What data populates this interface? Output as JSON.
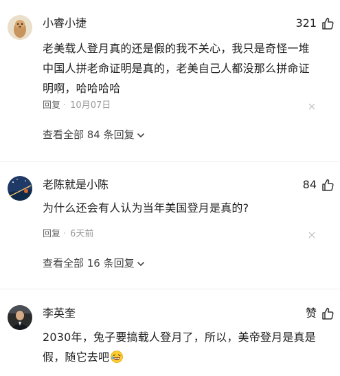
{
  "comments": [
    {
      "user": "小睿小捷",
      "likes": "321",
      "text": "老美载人登月真的还是假的我不关心，我只是奇怪一堆中国人拼老命证明是真的，老美自己人都没那么拼命证明啊，哈哈哈哈",
      "reply_label": "回复",
      "date": "10月07日",
      "view_replies": "查看全部 84 条回复"
    },
    {
      "user": "老陈就是小陈",
      "likes": "84",
      "text": "为什么还会有人认为当年美国登月是真的?",
      "reply_label": "回复",
      "date": "6天前",
      "view_replies": "查看全部 16 条回复"
    },
    {
      "user": "李英奎",
      "likes": "赞",
      "text": "2030年，兔子要搞载人登月了，所以，美帝登月是真是假，随它去吧"
    }
  ],
  "icons": {
    "like": "thumbs-up-icon",
    "close": "close-icon",
    "expand": "chevron-down-icon",
    "emoji": "laughing-emoji-icon"
  },
  "colors": {
    "text": "#222222",
    "meta": "#666666",
    "date": "#999999",
    "divider": "#eeeeee"
  }
}
